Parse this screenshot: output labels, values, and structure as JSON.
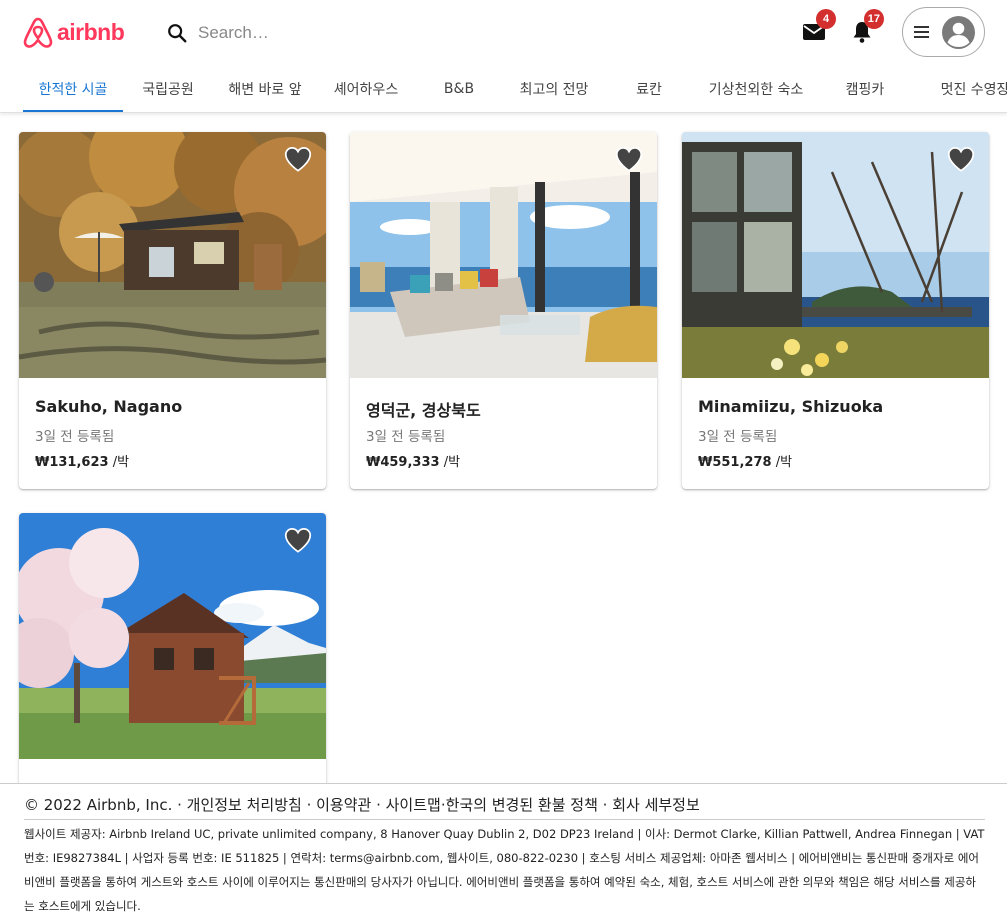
{
  "header": {
    "logo_text": "airbnb",
    "search_placeholder": "Search…",
    "messages_count": "4",
    "notifications_count": "17",
    "brand_color": "#ff385c"
  },
  "tabs": [
    {
      "label": "한적한 시골",
      "active": true
    },
    {
      "label": "국립공원"
    },
    {
      "label": "해변 바로 앞"
    },
    {
      "label": "셰어하우스"
    },
    {
      "label": "B&B"
    },
    {
      "label": "최고의 전망"
    },
    {
      "label": "료칸"
    },
    {
      "label": "기상천외한 숙소"
    },
    {
      "label": "캠핑카"
    },
    {
      "label": "멋진 수영장"
    }
  ],
  "listings": [
    {
      "title": "Sakuho, Nagano",
      "posted": "3일 전 등록됨",
      "price": "₩131,623",
      "unit": " /박",
      "icon": "heart-icon"
    },
    {
      "title": "영덕군, 경상북도",
      "posted": "3일 전 등록됨",
      "price": "₩459,333",
      "unit": " /박",
      "icon": "heart-icon"
    },
    {
      "title": "Minamiizu, Shizuoka",
      "posted": "3일 전 등록됨",
      "price": "₩551,278",
      "unit": " /박",
      "icon": "heart-icon"
    },
    {
      "title": "",
      "posted": "",
      "price": "",
      "unit": "",
      "icon": "heart-icon"
    }
  ],
  "footer": {
    "links": "© 2022 Airbnb, Inc. · 개인정보 처리방침 · 이용약관 · 사이트맵·한국의 변경된 환불 정책 · 회사 세부정보",
    "info": "웹사이트 제공자: Airbnb Ireland UC, private unlimited company, 8 Hanover Quay Dublin 2, D02 DP23 Ireland | 이사: Dermot Clarke, Killian Pattwell, Andrea Finnegan | VAT 번호: IE9827384L | 사업자 등록 번호: IE 511825 | 연락처: terms@airbnb.com, 웹사이트, 080-822-0230 | 호스팅 서비스 제공업체: 아마존 웹서비스 | 에어비앤비는 통신판매 중개자로 에어비앤비 플랫폼을 통하여 게스트와 호스트 사이에 이루어지는 통신판매의 당사자가 아닙니다. 에어비앤비 플랫폼을 통하여 예약된 숙소, 체험, 호스트 서비스에 관한 의무와 책임은 해당 서비스를 제공하는 호스트에게 있습니다."
  }
}
